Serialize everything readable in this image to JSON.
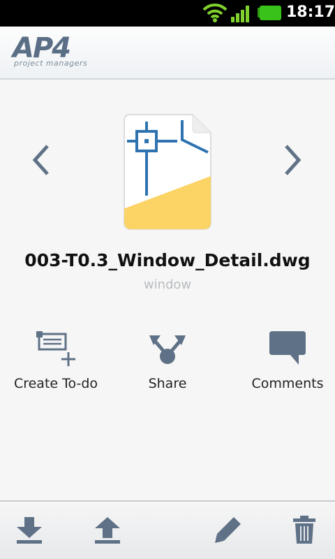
{
  "status_bar": {
    "time": "18:17"
  },
  "header": {
    "logo_main": "AP4",
    "logo_sub": "project managers"
  },
  "preview": {
    "file_name": "003-T0.3_Window_Detail.dwg",
    "file_subtitle": "window",
    "icon": "dwg-file-icon"
  },
  "actions": [
    {
      "label": "Create To-do",
      "icon": "create-todo-icon"
    },
    {
      "label": "Share",
      "icon": "share-icon"
    },
    {
      "label": "Comments",
      "icon": "comments-icon"
    }
  ],
  "toolbar": {
    "items": [
      "download-icon",
      "upload-icon",
      "edit-icon",
      "delete-icon"
    ]
  },
  "colors": {
    "icon_slate": "#5f7186",
    "accent_yellow": "#fbd465",
    "drawing_blue": "#2e73b0",
    "battery_green": "#39c21a"
  }
}
